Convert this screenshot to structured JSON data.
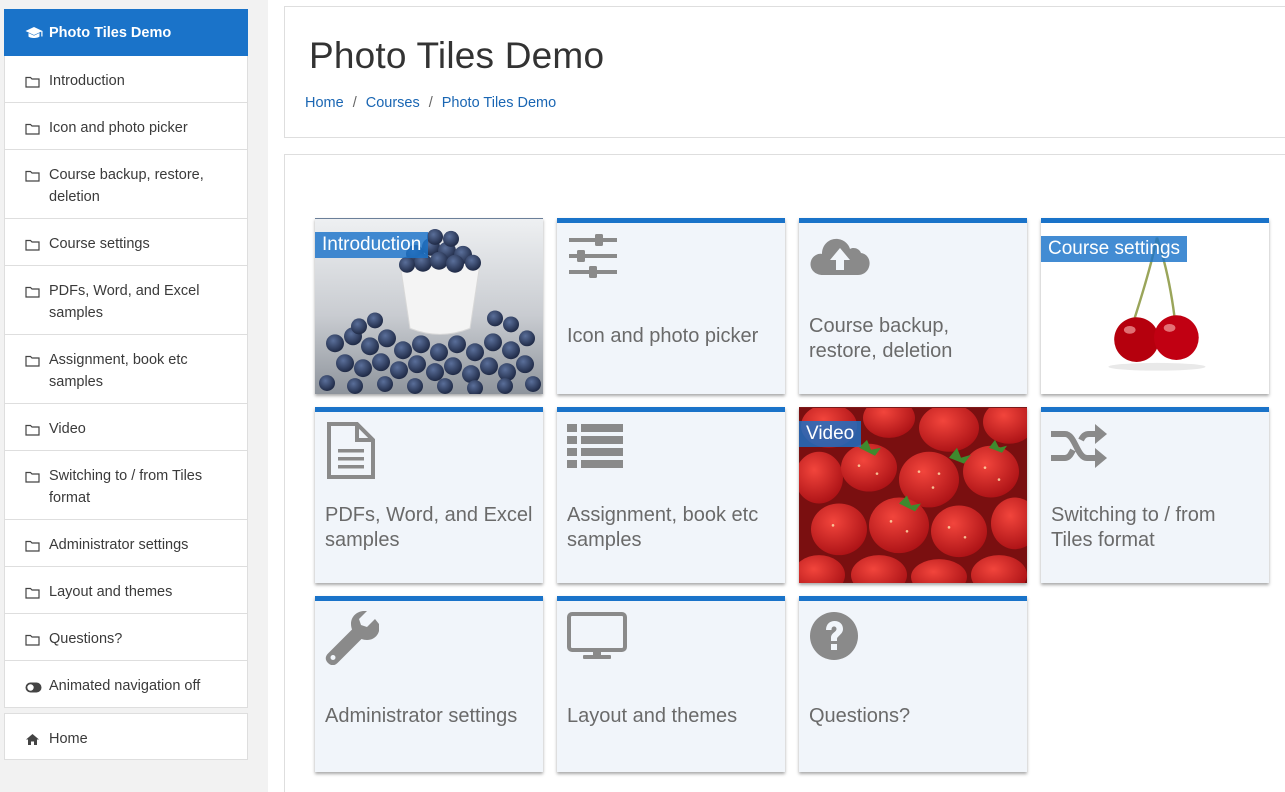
{
  "sidebar": {
    "course_title": "Photo Tiles Demo",
    "items": [
      {
        "label": "Introduction"
      },
      {
        "label": "Icon and photo picker"
      },
      {
        "label": "Course backup, restore, deletion"
      },
      {
        "label": "Course settings"
      },
      {
        "label": "PDFs, Word, and Excel samples"
      },
      {
        "label": "Assignment, book etc samples"
      },
      {
        "label": "Video"
      },
      {
        "label": "Switching to / from Tiles format"
      },
      {
        "label": "Administrator settings"
      },
      {
        "label": "Layout and themes"
      },
      {
        "label": "Questions?"
      }
    ],
    "animated_nav_label": "Animated navigation off",
    "home_label": "Home"
  },
  "header": {
    "title": "Photo Tiles Demo",
    "breadcrumb": [
      "Home",
      "Courses",
      "Photo Tiles Demo"
    ],
    "breadcrumb_separator": "/"
  },
  "tiles": [
    {
      "label": "Introduction",
      "kind": "photo",
      "photo": "blueberries"
    },
    {
      "label": "Icon and photo picker",
      "kind": "icon",
      "icon": "sliders-icon"
    },
    {
      "label": "Course backup, restore, deletion",
      "kind": "icon",
      "icon": "cloud-upload-icon"
    },
    {
      "label": "Course settings",
      "kind": "photo",
      "photo": "cherries"
    },
    {
      "label": "PDFs, Word, and Excel samples",
      "kind": "icon",
      "icon": "file-text-icon"
    },
    {
      "label": "Assignment, book etc samples",
      "kind": "icon",
      "icon": "list-icon"
    },
    {
      "label": "Video",
      "kind": "photo",
      "photo": "strawberries"
    },
    {
      "label": "Switching to / from Tiles format",
      "kind": "icon",
      "icon": "shuffle-icon"
    },
    {
      "label": "Administrator settings",
      "kind": "icon",
      "icon": "wrench-icon"
    },
    {
      "label": "Layout and themes",
      "kind": "icon",
      "icon": "desktop-icon"
    },
    {
      "label": "Questions?",
      "kind": "icon",
      "icon": "question-circle-icon"
    }
  ],
  "colors": {
    "accent": "#1a73c9",
    "tile_bg": "#f1f5fa",
    "icon_gray": "#8a8a8a",
    "link": "#1a66b3"
  }
}
